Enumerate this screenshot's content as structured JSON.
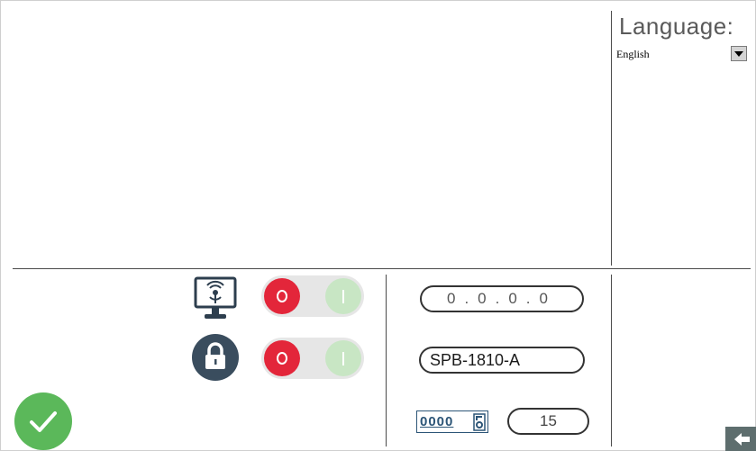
{
  "language": {
    "title": "Language:",
    "selected": "English"
  },
  "switches": [
    {
      "name": "remote-display",
      "icon": "wireless-monitor-icon",
      "state": "off"
    },
    {
      "name": "lock",
      "icon": "padlock-icon",
      "state": "off"
    }
  ],
  "network": {
    "ip_address": "0.0.0.0",
    "hostname": "SPB-1810-A"
  },
  "counter": {
    "digits": "0000",
    "value": "15"
  },
  "colors": {
    "toggle_off": "#e3263a",
    "toggle_on": "#c8e6c4",
    "confirm": "#5bb85a",
    "lock_badge": "#3a4d5e",
    "counter_blue": "#2c5577"
  }
}
